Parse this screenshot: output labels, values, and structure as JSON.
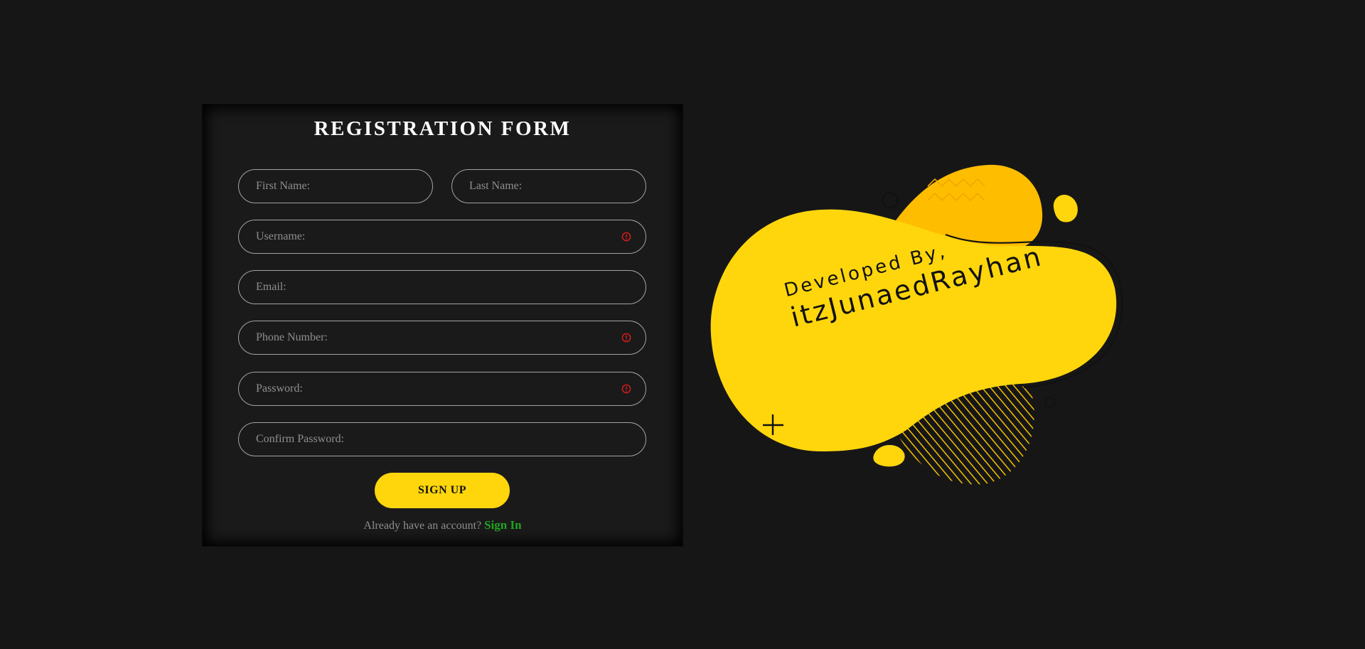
{
  "form": {
    "title": "REGISTRATION FORM",
    "fields": {
      "first_name": {
        "placeholder": "First Name:",
        "value": ""
      },
      "last_name": {
        "placeholder": "Last Name:",
        "value": ""
      },
      "username": {
        "placeholder": "Username:",
        "value": "",
        "icon": "alert-circle-icon"
      },
      "email": {
        "placeholder": "Email:",
        "value": ""
      },
      "phone": {
        "placeholder": "Phone Number:",
        "value": "",
        "icon": "alert-circle-icon"
      },
      "password": {
        "placeholder": "Password:",
        "value": "",
        "icon": "alert-circle-icon"
      },
      "confirm_password": {
        "placeholder": "Confirm Password:",
        "value": ""
      }
    },
    "submit_label": "SIGN UP",
    "signin_prompt": "Already have an account?",
    "signin_link": "Sign In"
  },
  "credit": {
    "line1": "Developed By,",
    "line2": "itzJunaedRayhan"
  },
  "colors": {
    "background": "#171617",
    "accent_yellow": "#ffd60c",
    "accent_orange": "#ffbd00",
    "link_green": "#1fa51f",
    "warning_red": "#e01b1b"
  }
}
